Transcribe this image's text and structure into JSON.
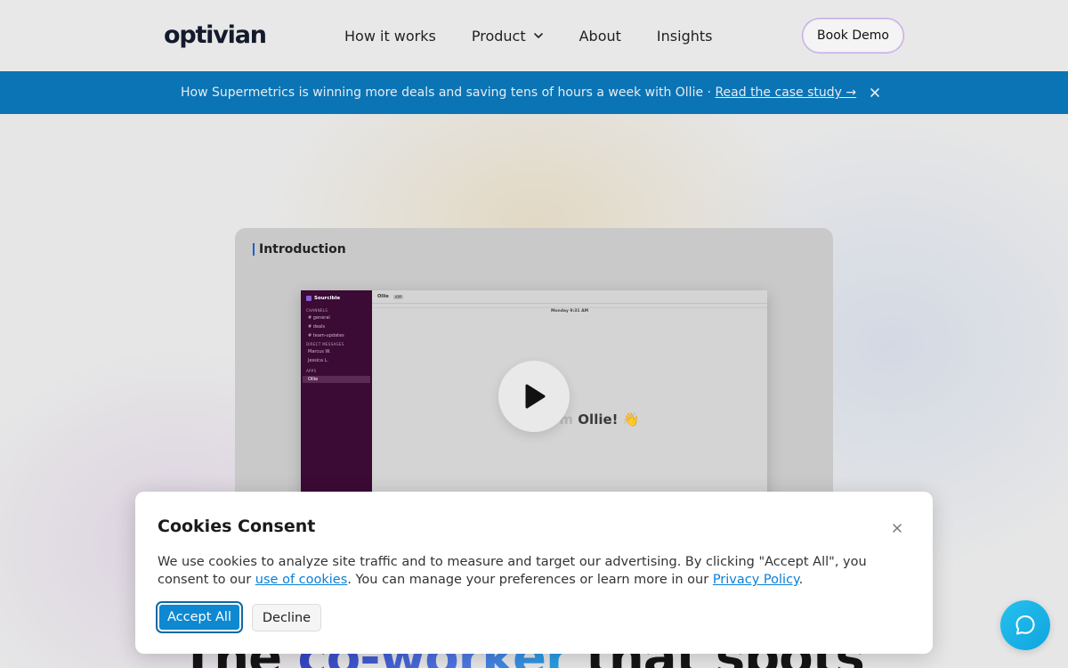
{
  "header": {
    "logo": "optivian",
    "nav": [
      {
        "label": "How it works"
      },
      {
        "label": "Product"
      },
      {
        "label": "About"
      },
      {
        "label": "Insights"
      }
    ],
    "cta_label": "Book Demo"
  },
  "banner": {
    "text": "How Supermetrics is winning more deals and saving tens of hours a week with Ollie · ",
    "link": "Read the case study →"
  },
  "video": {
    "title": "Introduction",
    "mock": {
      "workspace": "Sourcible",
      "section_channels": "CHANNELS",
      "channels": [
        "# general",
        "# deals",
        "# team-updates"
      ],
      "section_dms": "DIRECT MESSAGES",
      "dms": [
        "Marcus W.",
        "Jessica L."
      ],
      "section_apps": "APPS",
      "apps": [
        "Ollie"
      ],
      "top_name": "Ollie",
      "top_badge": "APP",
      "date": "Monday 9:31 AM",
      "greeting_faded": "Hey, I'm ",
      "greeting_bold": "Ollie! 👋"
    }
  },
  "headline": {
    "pre": "The ",
    "accent": "co-worker",
    "post": " that spots"
  },
  "cookie": {
    "title": "Cookies Consent",
    "text_1": "We use cookies to analyze site traffic and to measure and target our advertising. By clicking \"Accept All\", you consent to our ",
    "link_1": "use of cookies",
    "text_2": ". You can manage your preferences or learn more in our ",
    "link_2": "Privacy Policy",
    "text_3": ".",
    "accept_label": "Accept All",
    "decline_label": "Decline"
  },
  "colors": {
    "banner_bg": "#0a74b5",
    "accept_bg": "#0e88d0",
    "chat_bg": "#1eb4e8",
    "mock_sidebar": "#3b0a35"
  }
}
